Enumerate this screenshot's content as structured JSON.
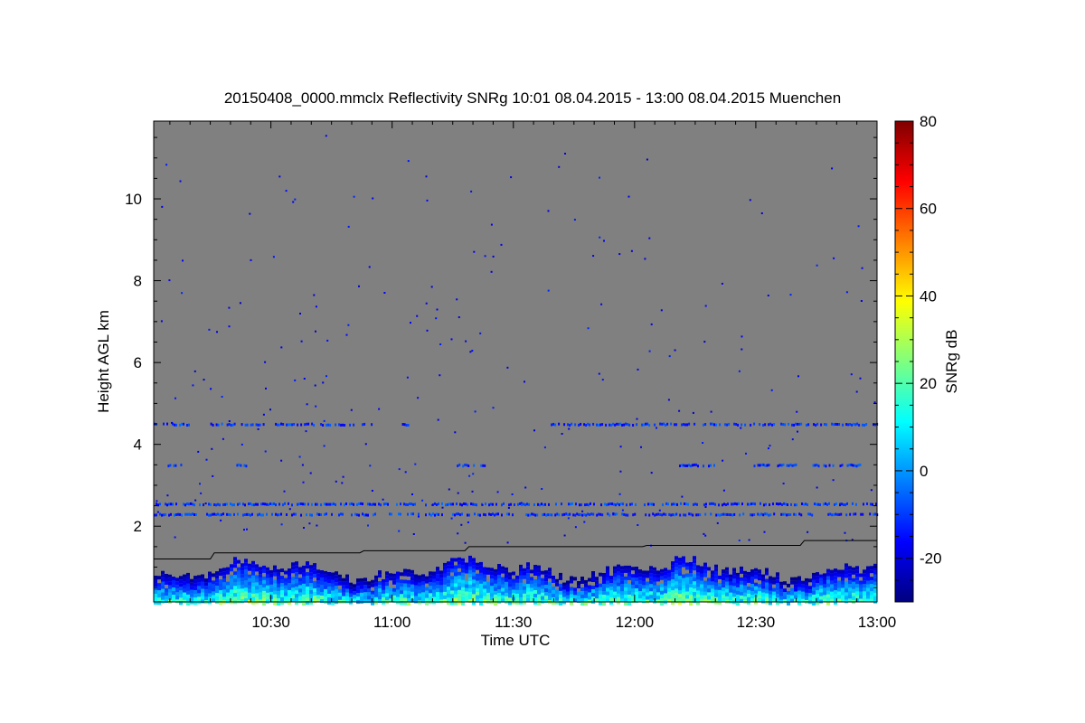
{
  "chart_data": {
    "type": "heatmap",
    "title": "20150408_0000.mmclx Reflectivity SNRg   10:01 08.04.2015 - 13:00 08.04.2015 Muenchen",
    "xlabel": "Time UTC",
    "ylabel": "Height AGL km",
    "x_range_minutes": [
      601,
      780
    ],
    "x_ticks": [
      {
        "value": 630,
        "label": "10:30"
      },
      {
        "value": 660,
        "label": "11:00"
      },
      {
        "value": 690,
        "label": "11:30"
      },
      {
        "value": 720,
        "label": "12:00"
      },
      {
        "value": 750,
        "label": "12:30"
      },
      {
        "value": 780,
        "label": "13:00"
      }
    ],
    "ylim": [
      0.15,
      11.9
    ],
    "y_ticks": [
      {
        "value": 2,
        "label": "2"
      },
      {
        "value": 4,
        "label": "4"
      },
      {
        "value": 6,
        "label": "6"
      },
      {
        "value": 8,
        "label": "8"
      },
      {
        "value": 10,
        "label": "10"
      }
    ],
    "background_color": "#808080",
    "colorbar": {
      "label": "SNRg dB",
      "range": [
        -30,
        80
      ],
      "ticks": [
        {
          "value": -20,
          "label": "-20"
        },
        {
          "value": 0,
          "label": "0"
        },
        {
          "value": 20,
          "label": "20"
        },
        {
          "value": 40,
          "label": "40"
        },
        {
          "value": 60,
          "label": "60"
        },
        {
          "value": 80,
          "label": "80"
        }
      ],
      "colormap": [
        "#00007f",
        "#0000ff",
        "#007fff",
        "#00ffff",
        "#7fff7f",
        "#ffff00",
        "#ff7f00",
        "#ff0000",
        "#7f0000"
      ]
    },
    "cloud_top_line": [
      [
        601,
        1.2
      ],
      [
        615,
        1.2
      ],
      [
        616,
        1.35
      ],
      [
        652,
        1.35
      ],
      [
        653,
        1.4
      ],
      [
        678,
        1.4
      ],
      [
        679,
        1.5
      ],
      [
        722,
        1.5
      ],
      [
        723,
        1.53
      ],
      [
        761,
        1.53
      ],
      [
        762,
        1.65
      ],
      [
        780,
        1.65
      ]
    ],
    "layers": [
      {
        "height": 4.5,
        "segments": [
          [
            601,
            610
          ],
          [
            615,
            628
          ],
          [
            631,
            655
          ],
          [
            662,
            664
          ],
          [
            697,
            780
          ]
        ]
      },
      {
        "height": 3.5,
        "segments": [
          [
            604,
            608
          ],
          [
            621,
            624
          ],
          [
            676,
            683
          ],
          [
            731,
            740
          ],
          [
            749,
            760
          ],
          [
            764,
            776
          ]
        ]
      },
      {
        "height": 2.55,
        "segments": [
          [
            601,
            780
          ]
        ]
      },
      {
        "height": 2.3,
        "segments": [
          [
            601,
            690
          ],
          [
            693,
            780
          ]
        ]
      }
    ],
    "boundary_layer_heights_km": [
      0.15,
      1.4
    ],
    "boundary_layer_snr_range_db": [
      -25,
      30
    ]
  }
}
